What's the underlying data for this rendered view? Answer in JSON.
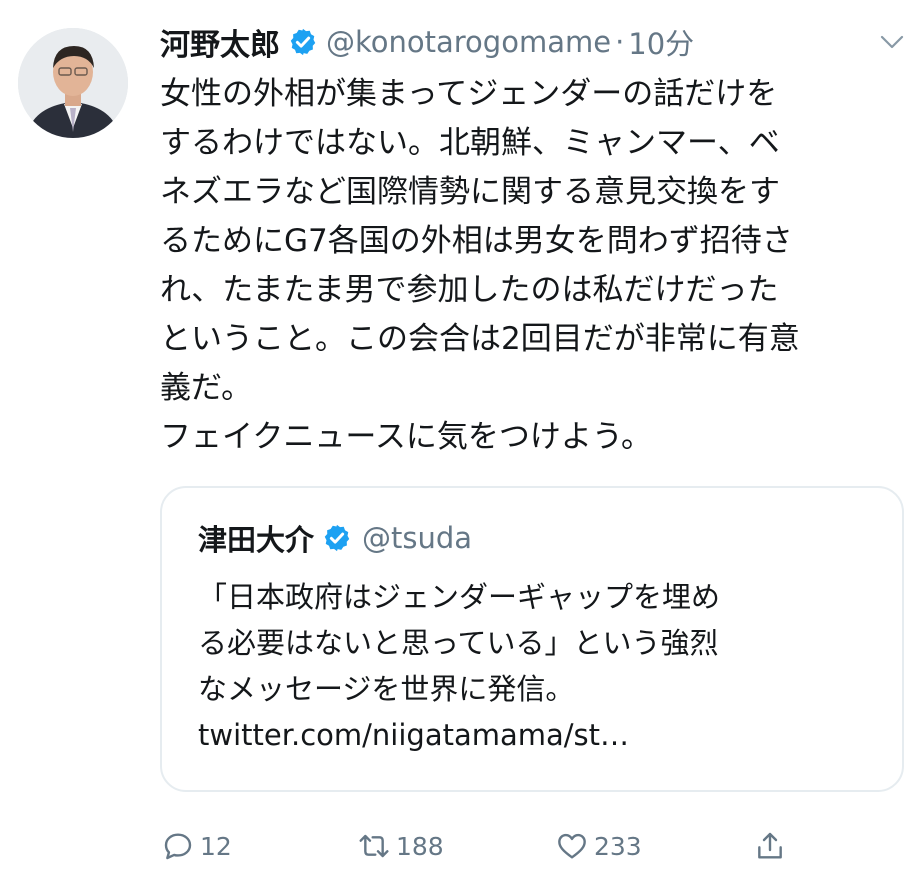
{
  "tweet": {
    "author_name": "河野太郎",
    "handle": "@konotarogomame",
    "separator": "·",
    "time": "10分",
    "text_lines": [
      "女性の外相が集まってジェンダーの話だけを",
      "するわけではない。北朝鮮、ミャンマー、ベ",
      "ネズエラなど国際情勢に関する意見交換をす",
      "るためにG7各国の外相は男女を問わず招待さ",
      "れ、たまたま男で参加したのは私だけだった",
      "ということ。この会合は2回目だが非常に有意",
      "義だ。",
      "フェイクニュースに気をつけよう。"
    ]
  },
  "quote": {
    "author_name": "津田大介",
    "handle": "@tsuda",
    "text_lines": [
      "「日本政府はジェンダーギャップを埋め",
      "る必要はないと思っている」という強烈",
      "なメッセージを世界に発信。",
      "twitter.com/niigatamama/st…"
    ]
  },
  "actions": {
    "reply_count": "12",
    "retweet_count": "188",
    "like_count": "233"
  },
  "colors": {
    "verified_blue": "#1da1f2",
    "secondary_text": "#657786",
    "border": "#e6ecf0"
  },
  "icons": [
    "verified-badge-icon",
    "chevron-down-icon",
    "reply-icon",
    "retweet-icon",
    "like-icon",
    "share-icon"
  ]
}
